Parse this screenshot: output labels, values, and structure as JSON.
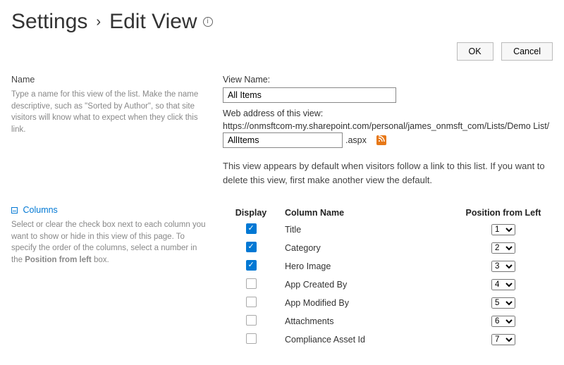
{
  "breadcrumb": {
    "root": "Settings",
    "current": "Edit View"
  },
  "actions": {
    "ok": "OK",
    "cancel": "Cancel"
  },
  "name_section": {
    "heading": "Name",
    "help": "Type a name for this view of the list. Make the name descriptive, such as \"Sorted by Author\", so that site visitors will know what to expect when they click this link.",
    "viewname_label": "View Name:",
    "viewname_value": "All Items",
    "webaddress_label": "Web address of this view:",
    "url_prefix": "https://onmsftcom-my.sharepoint.com/personal/james_onmsft_com/Lists/Demo List/",
    "url_value": "AllItems",
    "url_suffix": ".aspx",
    "default_note": "This view appears by default when visitors follow a link to this list. If you want to delete this view, first make another view the default."
  },
  "columns_section": {
    "heading": "Columns",
    "help_a": "Select or clear the check box next to each column you want to show or hide in this view of this page. To specify the order of the columns, select a number in the ",
    "help_bold": "Position from left",
    "help_b": " box.",
    "th_display": "Display",
    "th_colname": "Column Name",
    "th_pos": "Position from Left",
    "rows": [
      {
        "checked": true,
        "name": "Title",
        "pos": "1"
      },
      {
        "checked": true,
        "name": "Category",
        "pos": "2"
      },
      {
        "checked": true,
        "name": "Hero Image",
        "pos": "3"
      },
      {
        "checked": false,
        "name": "App Created By",
        "pos": "4"
      },
      {
        "checked": false,
        "name": "App Modified By",
        "pos": "5"
      },
      {
        "checked": false,
        "name": "Attachments",
        "pos": "6"
      },
      {
        "checked": false,
        "name": "Compliance Asset Id",
        "pos": "7"
      }
    ]
  }
}
